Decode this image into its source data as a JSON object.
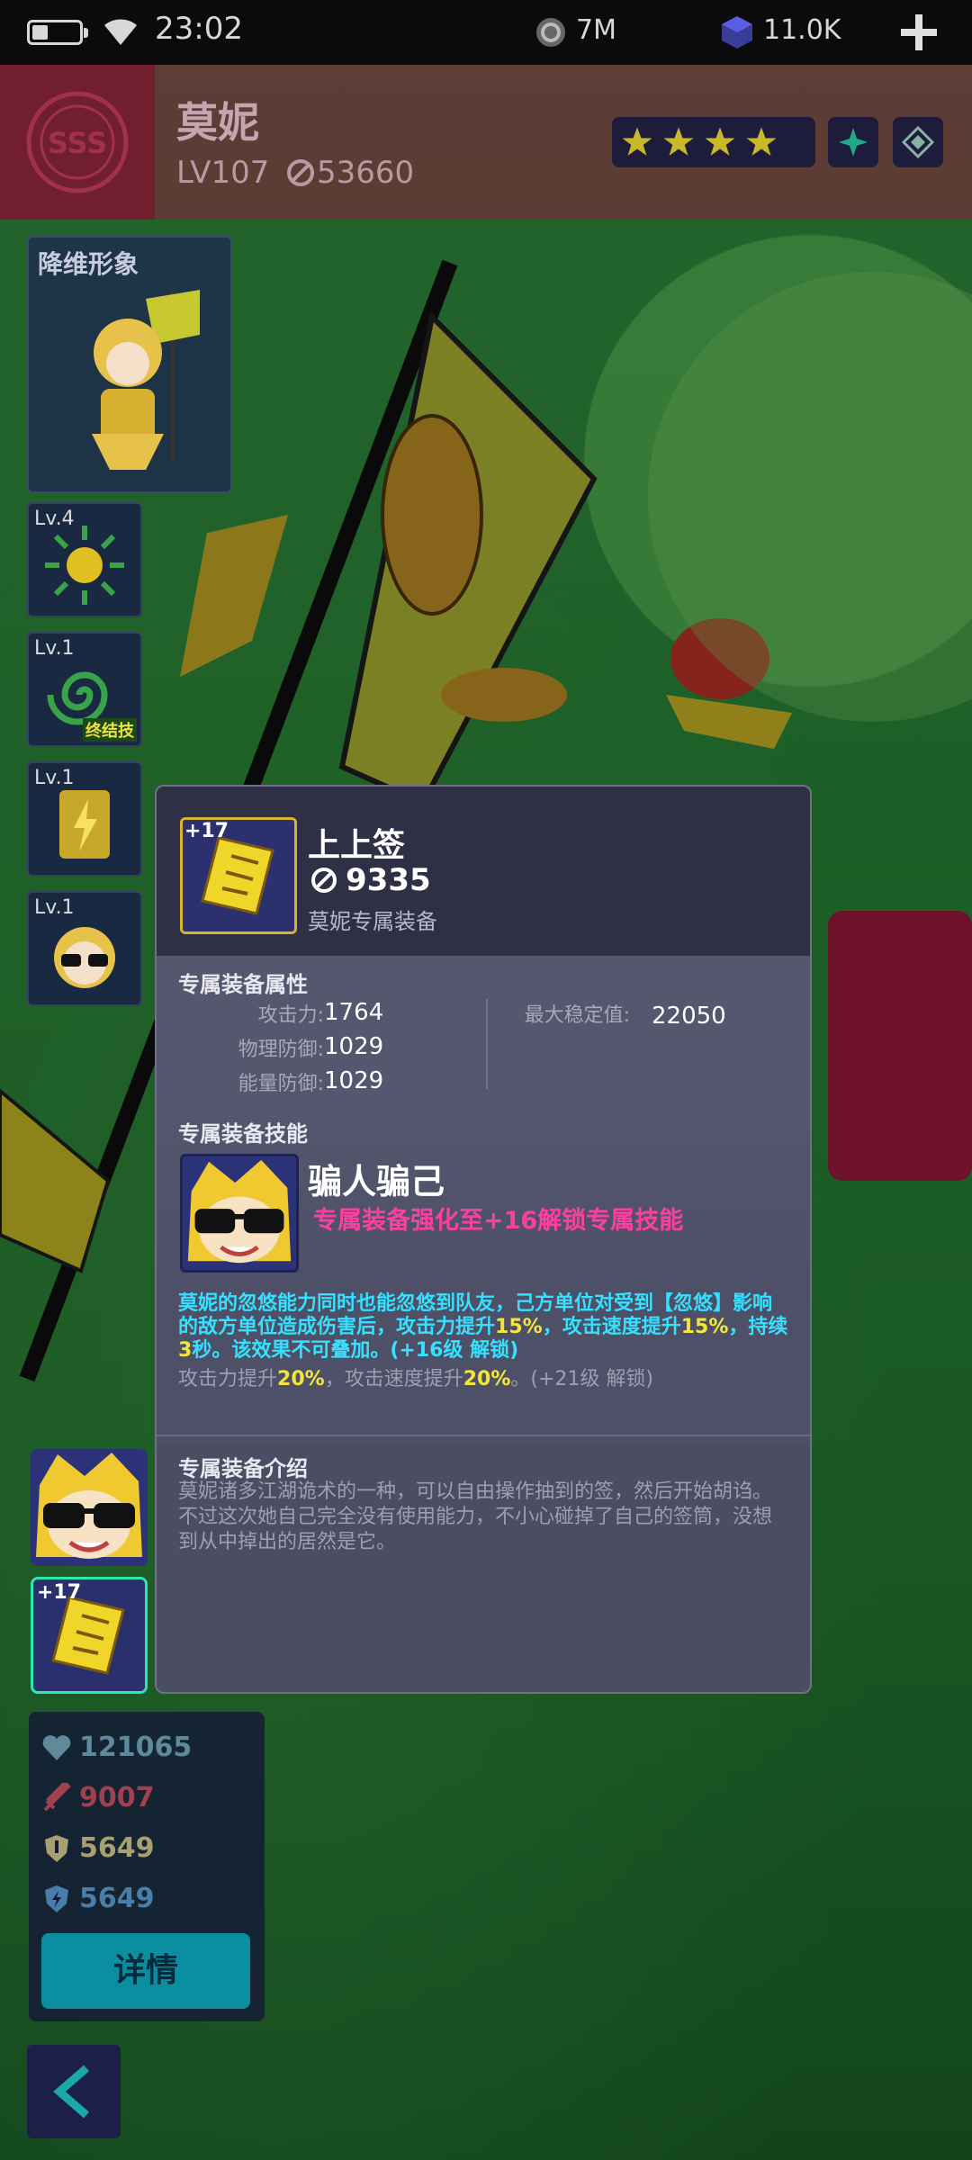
{
  "status_bar": {
    "time": "23:02",
    "battery_level": 0.3,
    "resource1": "7M",
    "resource2": "11.0K"
  },
  "hero": {
    "name": "莫妮",
    "level": "LV107",
    "power": "53660",
    "stars": 4
  },
  "left_panel": {
    "portrait_label": "降维形象",
    "skills": [
      {
        "level": "Lv.4",
        "icon": "sun-burst-icon"
      },
      {
        "level": "Lv.1",
        "icon": "spiral-ultimate-icon",
        "badge": "终结技"
      },
      {
        "level": "Lv.1",
        "icon": "lightning-card-icon"
      },
      {
        "level": "Lv.1",
        "icon": "sunglasses-face-icon"
      }
    ],
    "equip_level": "+17"
  },
  "stats": {
    "hp": "121065",
    "attack": "9007",
    "phys_def": "5649",
    "energy_def": "5649",
    "detail_label": "详情"
  },
  "popup": {
    "item_level": "+17",
    "item_name": "上上签",
    "item_power": "9335",
    "item_subtitle": "莫妮专属装备",
    "attr_title": "专属装备属性",
    "attrs": [
      {
        "label": "攻击力:",
        "value": "1764"
      },
      {
        "label": "物理防御:",
        "value": "1029"
      },
      {
        "label": "能量防御:",
        "value": "1029"
      }
    ],
    "max_stable_label": "最大稳定值:",
    "max_stable_value": "22050",
    "skill_title": "专属装备技能",
    "skill_name": "骗人骗己",
    "skill_unlock": "专属装备强化至+16解锁专属技能",
    "desc_part1": "莫妮的忽悠能力同时也能忽悠到队友，己方单位对受到【忽悠】影响的敌方单位造成伤害后，攻击力提升",
    "desc_pct1": "15%",
    "desc_part2": "，攻击速度提升",
    "desc_pct2": "15%",
    "desc_part3": "，持续",
    "desc_dur": "3",
    "desc_part4": "秒。该效果不可叠加。(+16级 解锁)",
    "desc2_part1": "攻击力提升",
    "desc2_pct1": "20%",
    "desc2_part2": "，攻击速度提升",
    "desc2_pct2": "20%",
    "desc2_part3": "。(+21级 解锁)",
    "intro_title": "专属装备介绍",
    "intro_text": "莫妮诸多江湖诡术的一种，可以自由操作抽到的签，然后开始胡诌。不过这次她自己完全没有使用能力，不小心碰掉了自己的签筒，没想到从中掉出的居然是它。"
  },
  "colors": {
    "accent_cyan": "#36e0ff",
    "accent_yellow": "#f2e63a",
    "accent_pink": "#ff3fa0",
    "equip_border": "#2ee6b0"
  }
}
